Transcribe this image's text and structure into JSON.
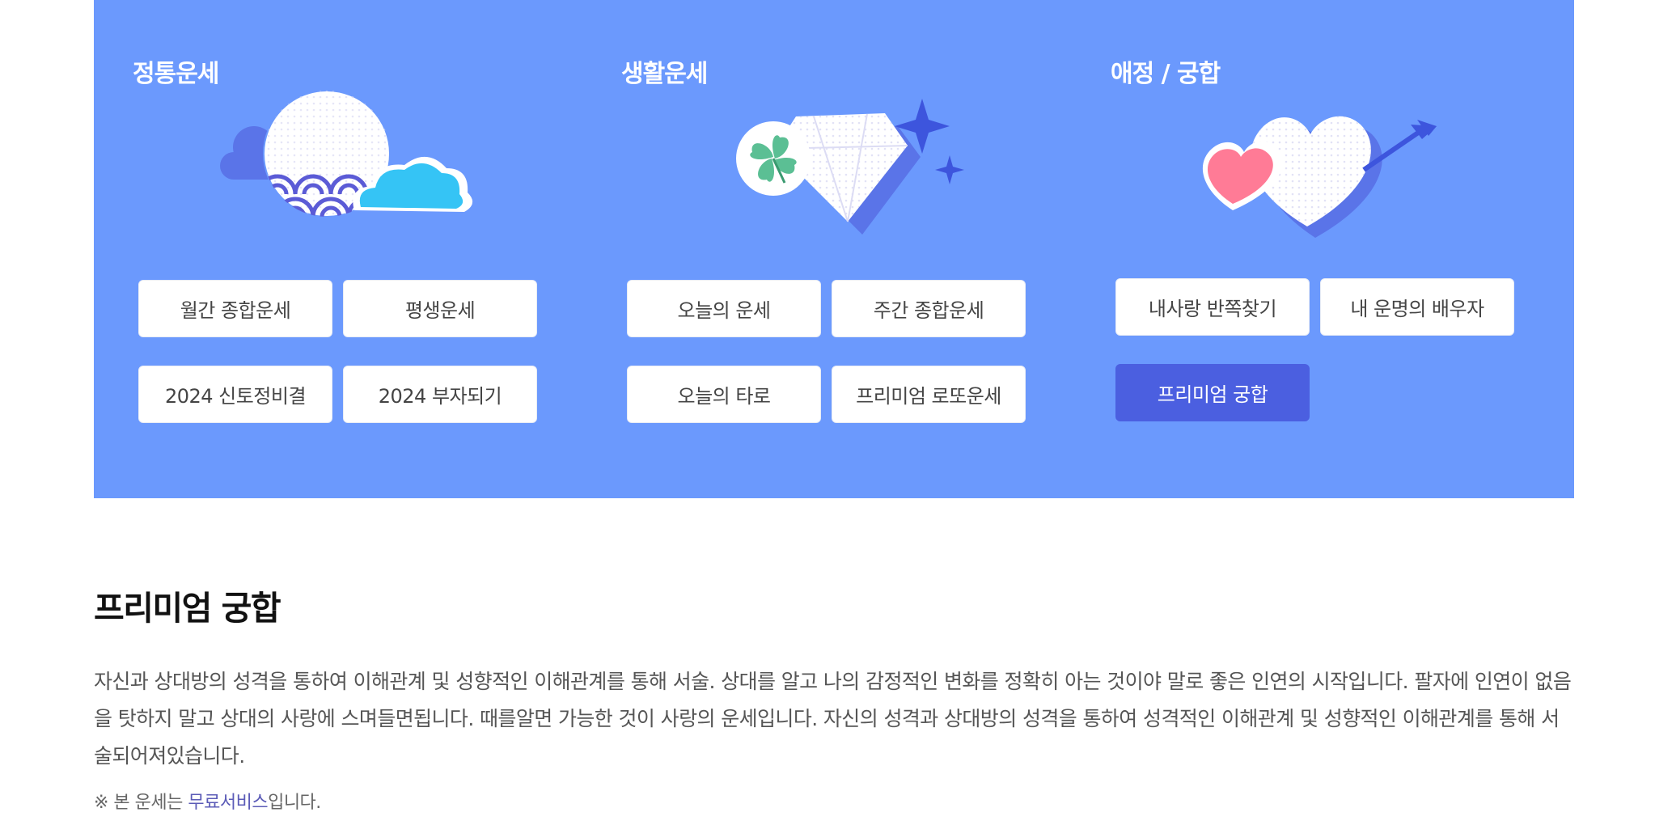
{
  "categories": [
    {
      "title": "정통운세",
      "icon": "moon-cloud-waves-icon",
      "buttons": [
        "월간 종합운세",
        "평생운세",
        "2024 신토정비결",
        "2024 부자되기"
      ]
    },
    {
      "title": "생활운세",
      "icon": "clover-diamond-sparkle-icon",
      "buttons": [
        "오늘의 운세",
        "주간 종합운세",
        "오늘의 타로",
        "프리미엄 로또운세"
      ]
    },
    {
      "title": "애정 / 궁합",
      "icon": "hearts-arrow-icon",
      "buttons": [
        "내사랑 반쪽찾기",
        "내 운명의 배우자",
        "프리미엄 궁합"
      ],
      "active_button": "프리미엄 궁합"
    }
  ],
  "section": {
    "title": "프리미엄 궁합",
    "description": "자신과 상대방의 성격을 통하여 이해관계 및 성향적인 이해관계를 통해 서술. 상대를 알고 나의 감정적인 변화를 정확히 아는 것이야 말로 좋은 인연의 시작입니다. 팔자에 인연이 없음을 탓하지 말고 상대의 사랑에 스며들면됩니다. 때를알면 가능한 것이 사랑의 운세입니다. 자신의 성격과 상대방의 성격을 통하여 성격적인 이해관계 및 성향적인 이해관계를 통해 서술되어져있습니다.",
    "note_prefix": "※ 본 운세는 ",
    "note_highlight": "무료서비스",
    "note_suffix": "입니다."
  },
  "colors": {
    "panel_bg": "#6b99fd",
    "active_button": "#4b5fe0",
    "note_highlight": "#5b5bb7"
  }
}
